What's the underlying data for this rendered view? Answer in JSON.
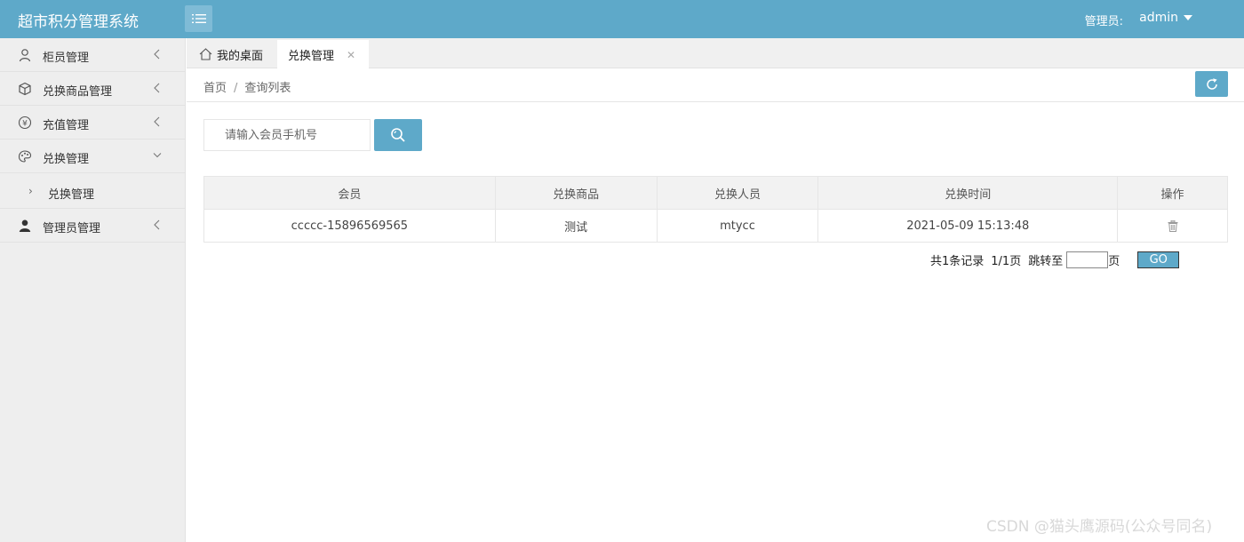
{
  "header": {
    "title": "超市积分管理系统",
    "admin_label": "管理员:",
    "admin_name": "admin",
    "accent_color": "#5ea9c9"
  },
  "sidebar": {
    "items": [
      {
        "label": "柜员管理",
        "icon": "user-outline-icon"
      },
      {
        "label": "兑换商品管理",
        "icon": "cube-icon"
      },
      {
        "label": "充值管理",
        "icon": "yen-circle-icon"
      },
      {
        "label": "兑换管理",
        "icon": "palette-icon",
        "expanded": true
      },
      {
        "label": "兑换管理",
        "sub": true
      },
      {
        "label": "管理员管理",
        "icon": "user-solid-icon"
      }
    ]
  },
  "tabs": [
    {
      "label": "我的桌面",
      "icon": "home-icon"
    },
    {
      "label": "兑换管理",
      "active": true
    }
  ],
  "breadcrumb": {
    "home": "首页",
    "separator": "/",
    "current": "查询列表"
  },
  "search": {
    "placeholder": "请输入会员手机号",
    "value": ""
  },
  "table": {
    "headers": [
      "会员",
      "兑换商品",
      "兑换人员",
      "兑换时间",
      "操作"
    ],
    "rows": [
      {
        "member": "ccccc-15896569565",
        "product": "测试",
        "operator": "mtycc",
        "time": "2021-05-09 15:13:48"
      }
    ]
  },
  "pagination": {
    "total_text": "共1条记录",
    "page_text": "1/1页",
    "jump_label": "跳转至",
    "page_suffix": "页",
    "go_label": "GO"
  },
  "watermark": "CSDN @猫头鹰源码(公众号同名)"
}
